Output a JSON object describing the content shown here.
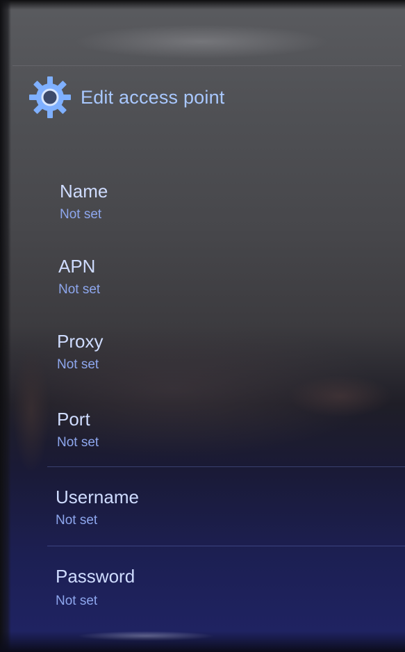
{
  "action_bar": {
    "icon": "gear-icon",
    "title": "Edit access point"
  },
  "preferences": [
    {
      "title": "Name",
      "summary": "Not set"
    },
    {
      "title": "APN",
      "summary": "Not set"
    },
    {
      "title": "Proxy",
      "summary": "Not set"
    },
    {
      "title": "Port",
      "summary": "Not set"
    },
    {
      "title": "Username",
      "summary": "Not set"
    },
    {
      "title": "Password",
      "summary": "Not set"
    }
  ],
  "colors": {
    "accent": "#a9c8ff",
    "title_text": "#cfdcff",
    "summary_text": "#8ea7ee"
  }
}
